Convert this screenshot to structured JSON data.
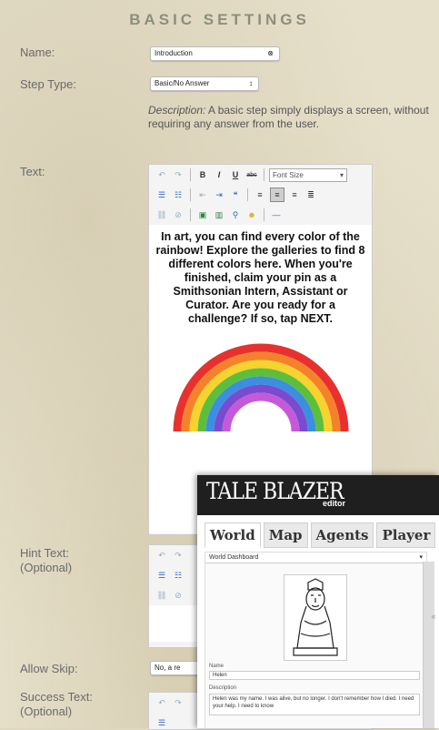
{
  "header": {
    "title": "BASIC SETTINGS"
  },
  "form": {
    "name_label": "Name:",
    "name_value": "Introduction",
    "step_type_label": "Step Type:",
    "step_type_value": "Basic/No Answer",
    "description_prefix": "Description:",
    "description_text": " A basic step simply displays a screen, without requiring any answer from the user.",
    "text_label": "Text:",
    "hint_label_line1": "Hint Text:",
    "hint_label_line2": "(Optional)",
    "allow_skip_label": "Allow Skip:",
    "allow_skip_value": "No, a re",
    "success_label_line1": "Success Text:",
    "success_label_line2": "(Optional)"
  },
  "editor": {
    "font_size_select": "Font Size",
    "content": "In art, you can find every color of the rainbow! Explore the galleries to find 8 different colors here. When you're finished, claim your pin as a Smithsonian Intern, Assistant or Curator. Are you ready for a challenge? If so, tap NEXT."
  },
  "rainbow_colors": [
    "#e8312f",
    "#f4822a",
    "#f6d32e",
    "#5cbf3c",
    "#3c8ee0",
    "#7a4bd0",
    "#c55ad8"
  ],
  "taleblazer": {
    "logo": "TALE BLAZER",
    "editor_label": "editor",
    "tabs": [
      "World",
      "Map",
      "Agents",
      "Player"
    ],
    "dropdown": "World Dashboard",
    "name_label": "Name",
    "name_value": "Helen",
    "description_label": "Description",
    "description_value": "Helen was my name. I was alive, but no longer. I don't remember how I died. I need your help. I need to know"
  }
}
